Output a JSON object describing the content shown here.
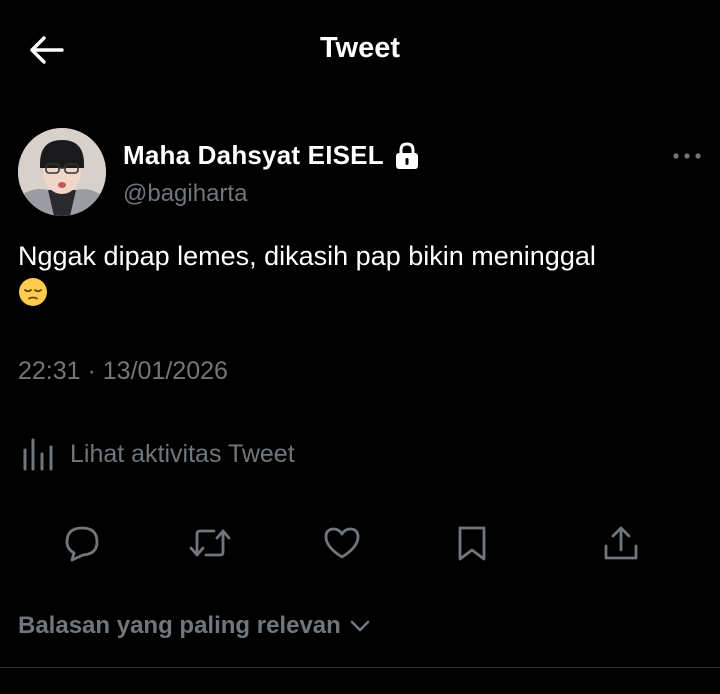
{
  "header": {
    "title": "Tweet"
  },
  "author": {
    "display_name": "Maha Dahsyat EISEL",
    "handle": "@bagiharta",
    "protected": true
  },
  "tweet": {
    "text": "Nggak dipap lemes, dikasih pap bikin meninggal",
    "emoji": "pensive-face",
    "timestamp": "22:31 · 13/01/2026"
  },
  "analytics": {
    "label": "Lihat aktivitas Tweet"
  },
  "actions": [
    "reply-icon",
    "retweet-icon",
    "like-icon",
    "bookmark-icon",
    "share-icon"
  ],
  "replies": {
    "sort_label": "Balasan yang paling relevan"
  },
  "colors": {
    "background": "#000000",
    "text": "#e7e9ea",
    "secondary": "#71767b",
    "divider": "#2f3336"
  }
}
